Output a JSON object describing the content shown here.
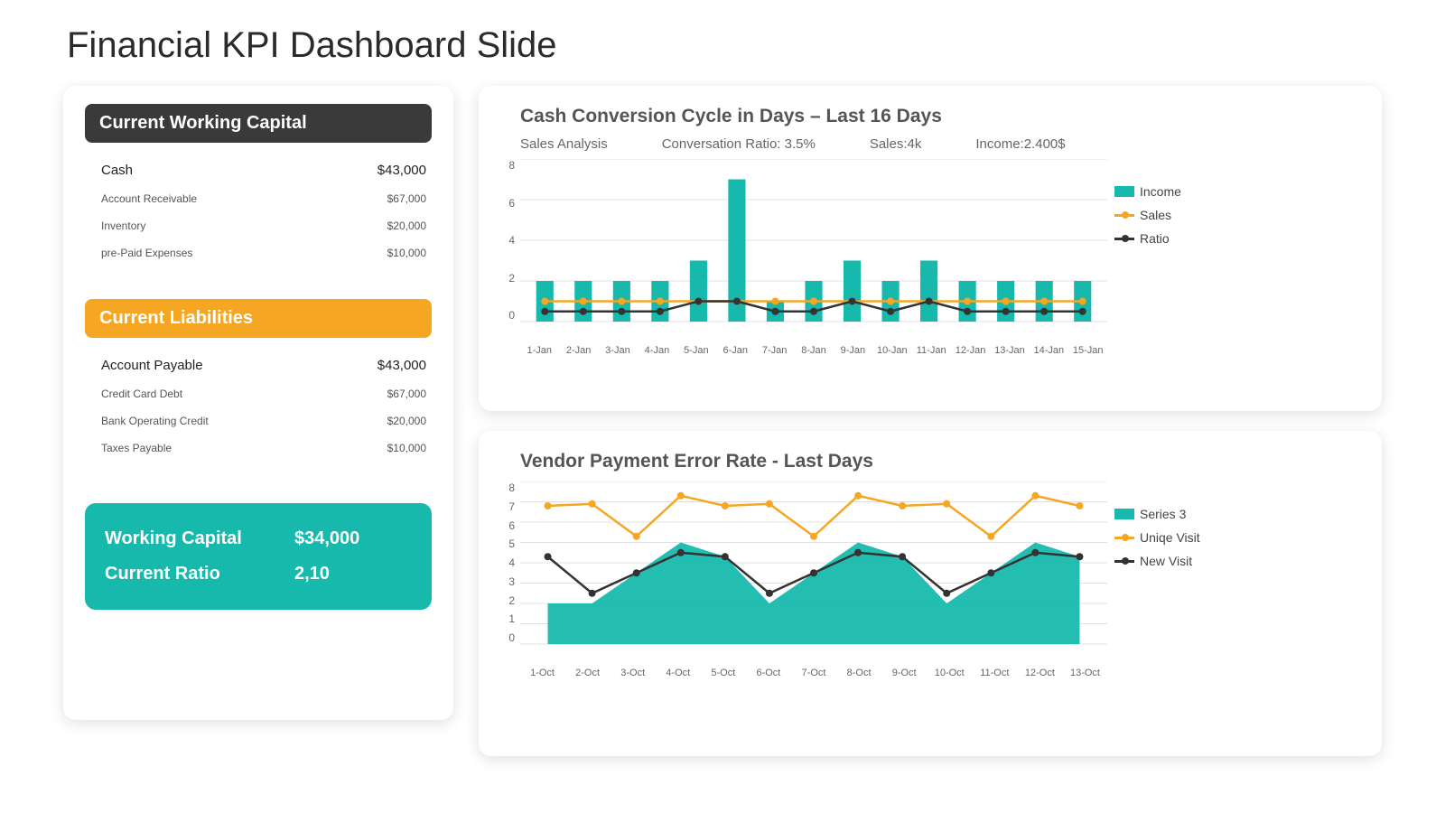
{
  "title": "Financial KPI Dashboard Slide",
  "colors": {
    "teal": "#17b9ad",
    "orange": "#f5a623",
    "dark": "#3a3a3a"
  },
  "left": {
    "capital": {
      "heading": "Current Working Capital",
      "rows": [
        {
          "label": "Cash",
          "value": "$43,000",
          "big": true
        },
        {
          "label": "Account Receivable",
          "value": "$67,000",
          "big": false
        },
        {
          "label": "Inventory",
          "value": "$20,000",
          "big": false
        },
        {
          "label": "pre-Paid Expenses",
          "value": "$10,000",
          "big": false
        }
      ]
    },
    "liabilities": {
      "heading": "Current Liabilities",
      "rows": [
        {
          "label": "Account Payable",
          "value": "$43,000",
          "big": true
        },
        {
          "label": "Credit Card Debt",
          "value": "$67,000",
          "big": false
        },
        {
          "label": "Bank Operating Credit",
          "value": "$20,000",
          "big": false
        },
        {
          "label": "Taxes Payable",
          "value": "$10,000",
          "big": false
        }
      ]
    },
    "summary": {
      "rows": [
        {
          "label": "Working Capital",
          "value": "$34,000"
        },
        {
          "label": "Current Ratio",
          "value": "2,10"
        }
      ]
    }
  },
  "chart1": {
    "title": "Cash Conversion Cycle in Days – Last 16 Days",
    "subtitle_items": [
      "Sales Analysis",
      "Conversation Ratio: 3.5%",
      "Sales:4k",
      "Income:2.400$"
    ],
    "legend": [
      {
        "label": "Income",
        "type": "bar",
        "color": "#17b9ad"
      },
      {
        "label": "Sales",
        "type": "line",
        "color": "#f5a623"
      },
      {
        "label": "Ratio",
        "type": "line",
        "color": "#333333"
      }
    ]
  },
  "chart2": {
    "title": "Vendor Payment Error Rate  - Last Days",
    "legend": [
      {
        "label": "Series 3",
        "type": "bar",
        "color": "#17b9ad"
      },
      {
        "label": "Uniqe Visit",
        "type": "line",
        "color": "#f5a623"
      },
      {
        "label": "New Visit",
        "type": "line",
        "color": "#333333"
      }
    ]
  },
  "chart_data": [
    {
      "type": "bar",
      "title": "Cash Conversion Cycle in Days – Last 16 Days",
      "xlabel": "",
      "ylabel": "",
      "ylim": [
        0,
        8
      ],
      "y_ticks": [
        0,
        2,
        4,
        6,
        8
      ],
      "categories": [
        "1-Jan",
        "2-Jan",
        "3-Jan",
        "4-Jan",
        "5-Jan",
        "6-Jan",
        "7-Jan",
        "8-Jan",
        "9-Jan",
        "10-Jan",
        "11-Jan",
        "12-Jan",
        "13-Jan",
        "14-Jan",
        "15-Jan"
      ],
      "series": [
        {
          "name": "Income",
          "type": "bar",
          "color": "#17b9ad",
          "values": [
            2,
            2,
            2,
            2,
            3,
            7,
            1,
            2,
            3,
            2,
            3,
            2,
            2,
            2,
            2
          ]
        },
        {
          "name": "Sales",
          "type": "line",
          "color": "#f5a623",
          "values": [
            1,
            1,
            1,
            1,
            1,
            1,
            1,
            1,
            1,
            1,
            1,
            1,
            1,
            1,
            1
          ]
        },
        {
          "name": "Ratio",
          "type": "line",
          "color": "#333333",
          "values": [
            0.5,
            0.5,
            0.5,
            0.5,
            1.0,
            1.0,
            0.5,
            0.5,
            1.0,
            0.5,
            1.0,
            0.5,
            0.5,
            0.5,
            0.5
          ]
        }
      ]
    },
    {
      "type": "area",
      "title": "Vendor Payment Error Rate  - Last Days",
      "xlabel": "",
      "ylabel": "",
      "ylim": [
        0,
        8
      ],
      "y_ticks": [
        0,
        1,
        2,
        3,
        4,
        5,
        6,
        7,
        8
      ],
      "categories": [
        "1-Oct",
        "2-Oct",
        "3-Oct",
        "4-Oct",
        "5-Oct",
        "6-Oct",
        "7-Oct",
        "8-Oct",
        "9-Oct",
        "10-Oct",
        "11-Oct",
        "12-Oct",
        "13-Oct"
      ],
      "series": [
        {
          "name": "Series 3",
          "type": "area",
          "color": "#17b9ad",
          "values": [
            2,
            2,
            3.5,
            5,
            4.3,
            2,
            3.5,
            5,
            4.3,
            2,
            3.5,
            5,
            4.3
          ]
        },
        {
          "name": "Uniqe Visit",
          "type": "line",
          "color": "#f5a623",
          "values": [
            6.8,
            6.9,
            5.3,
            7.3,
            6.8,
            6.9,
            5.3,
            7.3,
            6.8,
            6.9,
            5.3,
            7.3,
            6.8
          ]
        },
        {
          "name": "New Visit",
          "type": "line",
          "color": "#333333",
          "values": [
            4.3,
            2.5,
            3.5,
            4.5,
            4.3,
            2.5,
            3.5,
            4.5,
            4.3,
            2.5,
            3.5,
            4.5,
            4.3
          ]
        }
      ]
    }
  ]
}
